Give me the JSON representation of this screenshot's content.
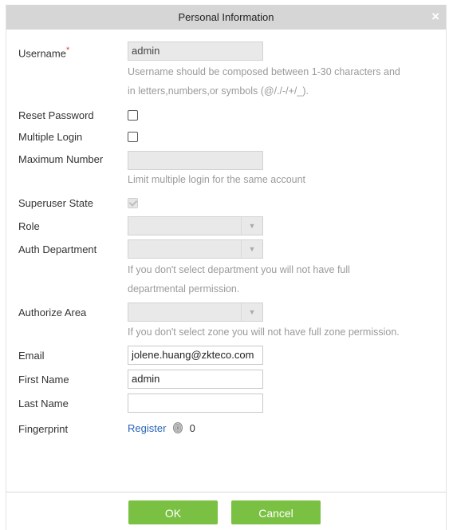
{
  "dialog": {
    "title": "Personal Information",
    "close_glyph": "×"
  },
  "fields": {
    "username": {
      "label": "Username",
      "required_mark": "*",
      "value": "admin",
      "hint_line1": "Username should be composed between 1-30 characters and",
      "hint_line2": "in letters,numbers,or symbols (@/./-/+/_)."
    },
    "reset_password": {
      "label": "Reset Password",
      "checked": false
    },
    "multiple_login": {
      "label": "Multiple Login",
      "checked": false
    },
    "maximum_number": {
      "label": "Maximum Number",
      "value": "",
      "hint": "Limit multiple login for the same account"
    },
    "superuser_state": {
      "label": "Superuser State",
      "checked": true,
      "disabled": true
    },
    "role": {
      "label": "Role",
      "value": ""
    },
    "auth_department": {
      "label": "Auth Department",
      "value": "",
      "hint_line1": "If you don't select department you will not have full",
      "hint_line2": "departmental permission."
    },
    "authorize_area": {
      "label": "Authorize Area",
      "value": "",
      "hint": "If you don't select zone you will not have full zone permission."
    },
    "email": {
      "label": "Email",
      "value": "jolene.huang@zkteco.com"
    },
    "first_name": {
      "label": "First Name",
      "value": "admin"
    },
    "last_name": {
      "label": "Last Name",
      "value": ""
    },
    "fingerprint": {
      "label": "Fingerprint",
      "register_label": "Register",
      "count": "0",
      "icon": "fingerprint-icon"
    }
  },
  "footer": {
    "ok_label": "OK",
    "cancel_label": "Cancel"
  },
  "colors": {
    "titlebar": "#d6d6d6",
    "button": "#7ac143",
    "link": "#2a63b5",
    "required": "#e4393c",
    "hint": "#9a9a9a"
  }
}
